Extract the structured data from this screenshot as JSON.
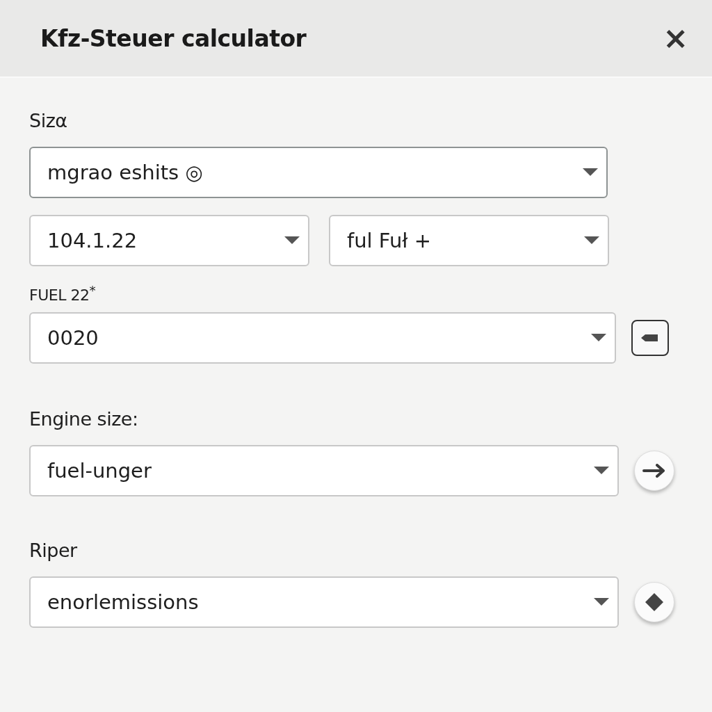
{
  "window": {
    "title": "Kfz-Steuer calculator",
    "close": "×"
  },
  "sections": [
    {
      "label": "Sizα",
      "rows": [
        {
          "fields": [
            {
              "value": "mgrao eshits ◎"
            }
          ]
        },
        {
          "fields": [
            {
              "value": "104.1.22"
            },
            {
              "value": "ful Fuł +"
            }
          ]
        }
      ]
    },
    {
      "label": "FUEL 22$^{*}$",
      "rows": [
        {
          "fields": [
            {
              "value": "0020"
            }
          ],
          "side_button": {
            "kind": "square"
          }
        }
      ]
    },
    {
      "label": "Engine size:",
      "rows": [
        {
          "fields": [
            {
              "value": "fuel-unger"
            }
          ],
          "side_button": {
            "kind": "arrow"
          }
        }
      ]
    },
    {
      "label": "Riper",
      "rows": [
        {
          "fields": [
            {
              "value": "enorlemissions"
            }
          ],
          "side_button": {
            "kind": "diamond"
          }
        }
      ]
    }
  ]
}
